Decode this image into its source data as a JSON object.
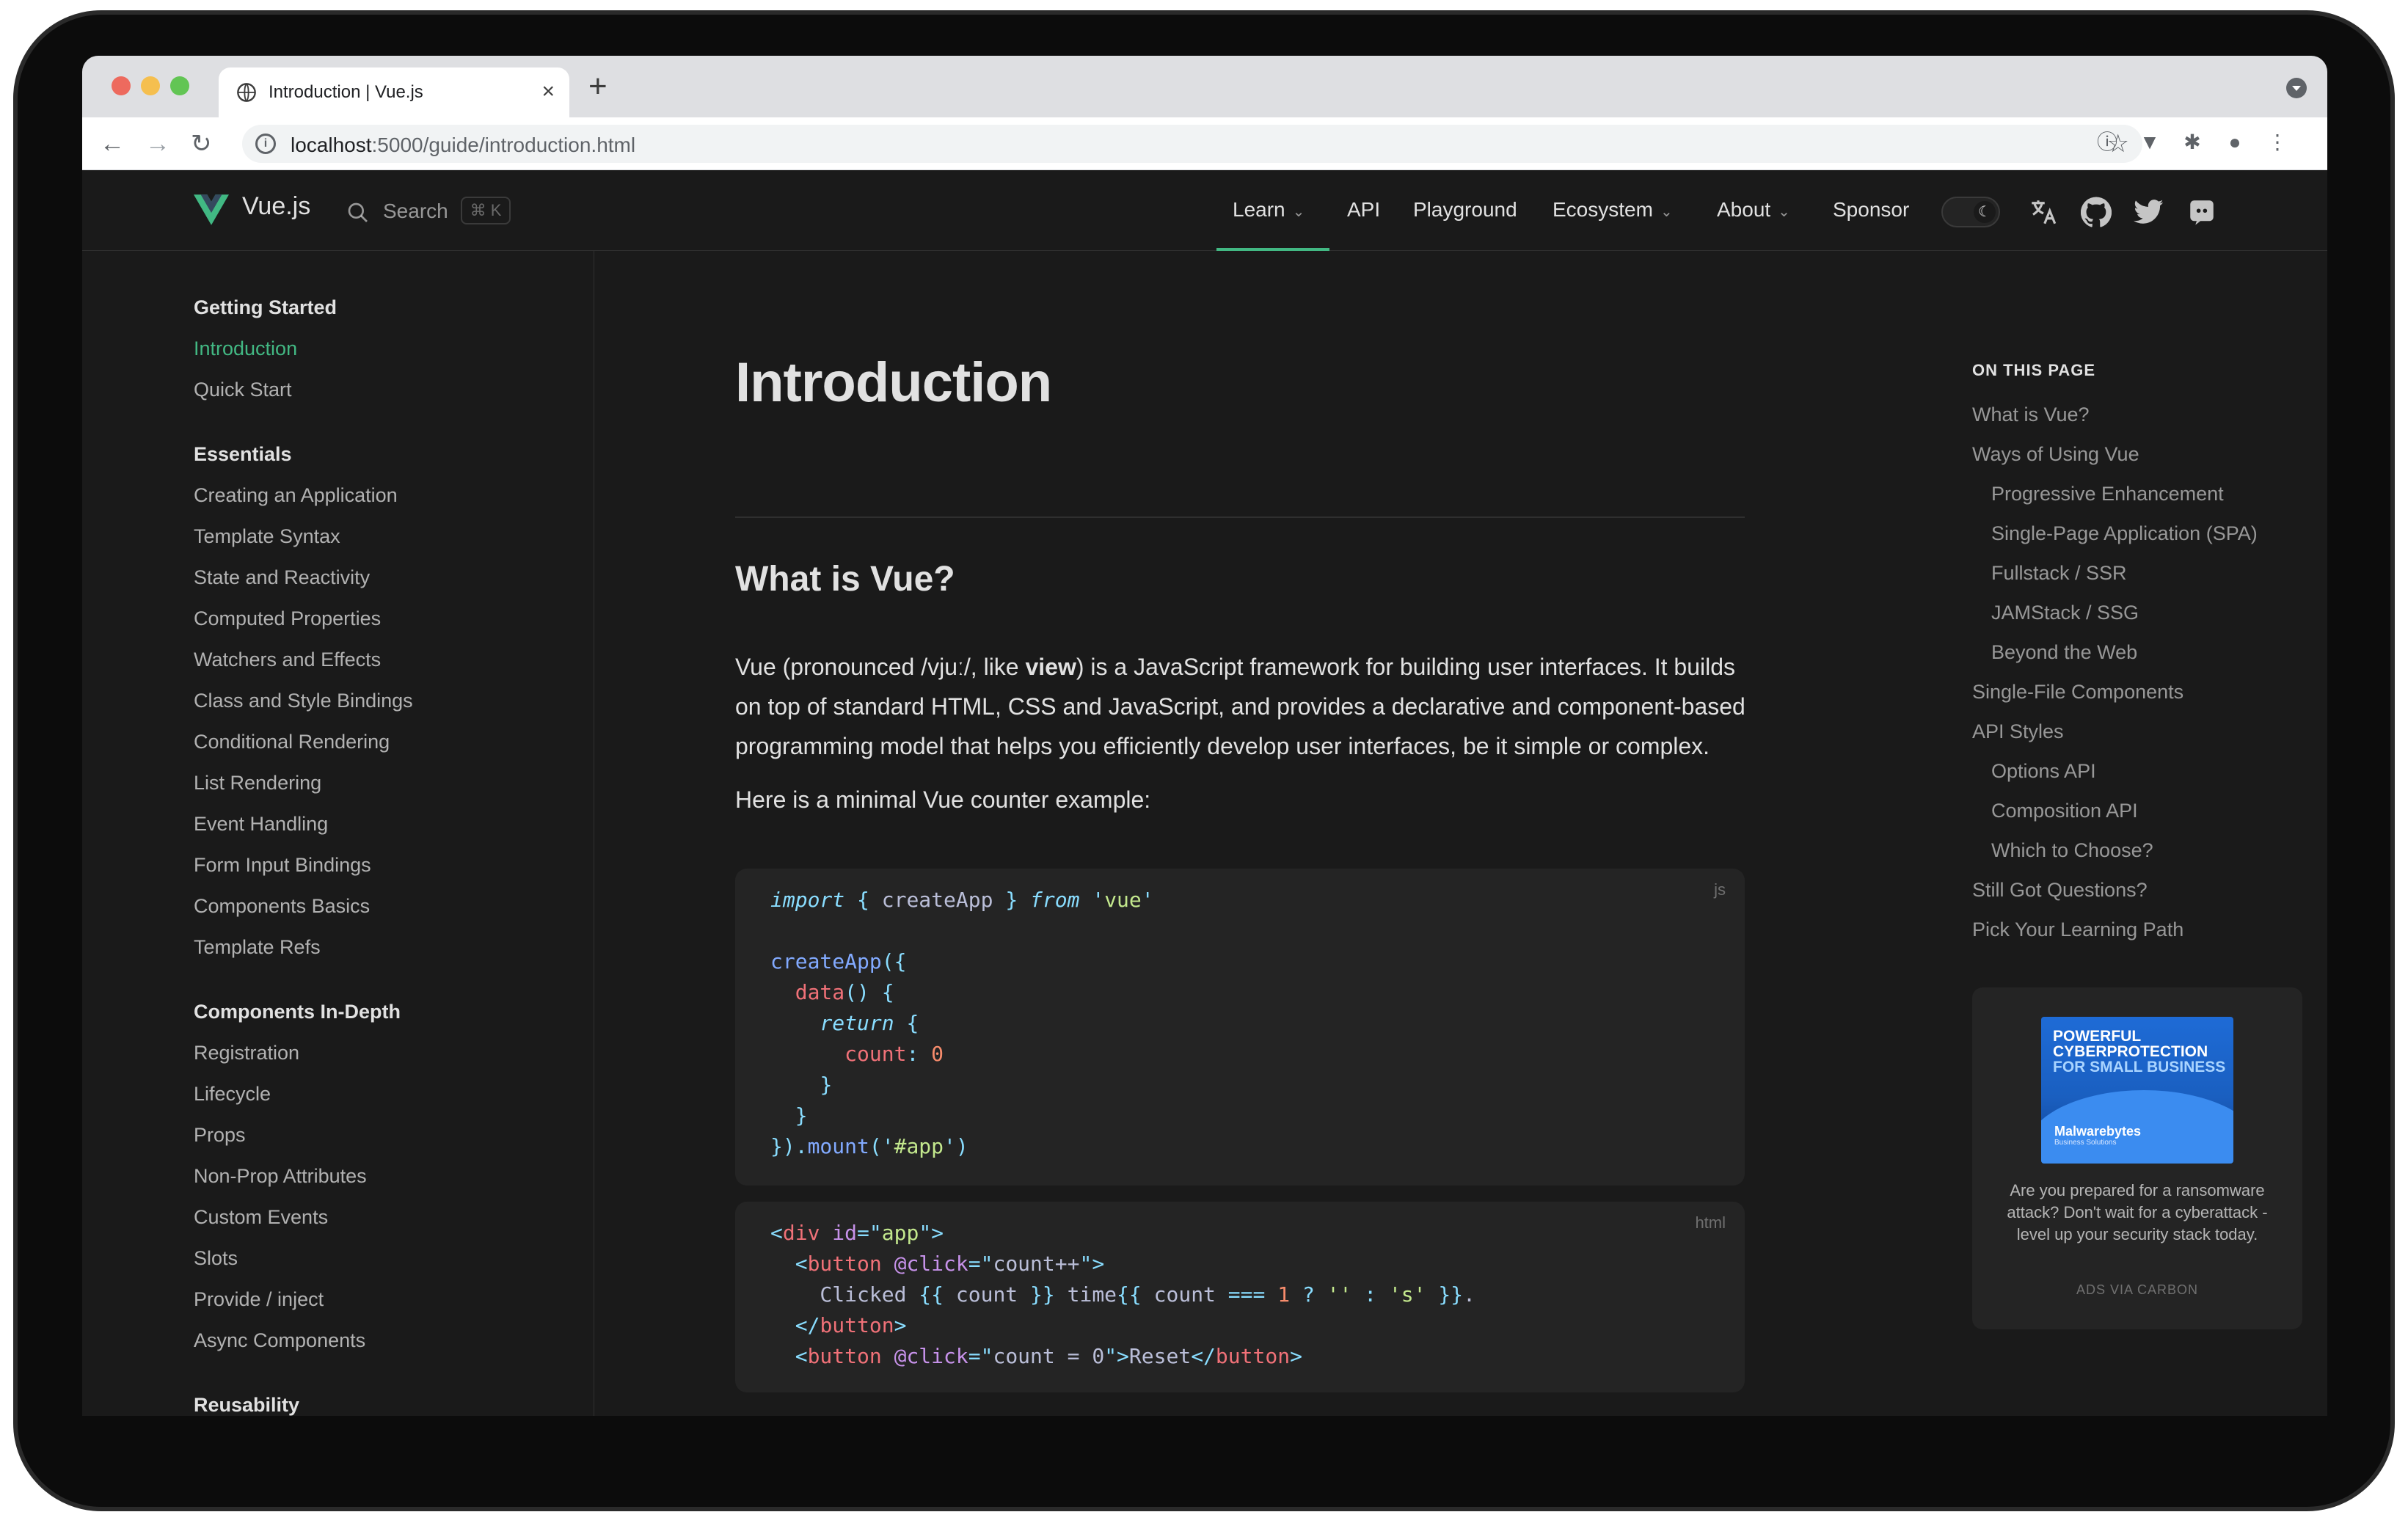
{
  "browser": {
    "tab_title": "Introduction | Vue.js",
    "url_host": "localhost",
    "url_rest": ":5000/guide/introduction.html",
    "new_tab_symbol": "+",
    "close_symbol": "×"
  },
  "nav": {
    "brand": "Vue.js",
    "search_label": "Search",
    "search_shortcut": "⌘ K",
    "items": [
      {
        "label": "Learn",
        "has_dropdown": true,
        "active": true
      },
      {
        "label": "API",
        "has_dropdown": false
      },
      {
        "label": "Playground",
        "has_dropdown": false
      },
      {
        "label": "Ecosystem",
        "has_dropdown": true
      },
      {
        "label": "About",
        "has_dropdown": true
      },
      {
        "label": "Sponsor",
        "has_dropdown": false
      }
    ],
    "chevron": "⌄",
    "accent_color": "#42b883"
  },
  "sidebar": {
    "groups": [
      {
        "title": "Getting Started",
        "items": [
          "Introduction",
          "Quick Start"
        ]
      },
      {
        "title": "Essentials",
        "items": [
          "Creating an Application",
          "Template Syntax",
          "State and Reactivity",
          "Computed Properties",
          "Watchers and Effects",
          "Class and Style Bindings",
          "Conditional Rendering",
          "List Rendering",
          "Event Handling",
          "Form Input Bindings",
          "Components Basics",
          "Template Refs"
        ]
      },
      {
        "title": "Components In-Depth",
        "items": [
          "Registration",
          "Lifecycle",
          "Props",
          "Non-Prop Attributes",
          "Custom Events",
          "Slots",
          "Provide / inject",
          "Async Components"
        ]
      },
      {
        "title": "Reusability",
        "items": []
      }
    ],
    "active_item": "Introduction"
  },
  "content": {
    "title": "Introduction",
    "section_title": "What is Vue?",
    "para_before": "Vue (pronounced /vjuː/, like ",
    "para_bold": "view",
    "para_after": ") is a JavaScript framework for building user interfaces. It builds on top of standard HTML, CSS and JavaScript, and provides a declarative and component-based programming model that helps you efficiently develop user interfaces, be it simple or complex.",
    "para2": "Here is a minimal Vue counter example:",
    "code_js_lang": "js",
    "code_html_lang": "html",
    "code_js": [
      [
        [
          "kw",
          "import"
        ],
        [
          "plain",
          " "
        ],
        [
          "punc",
          "{"
        ],
        [
          "plain",
          " createApp "
        ],
        [
          "punc",
          "}"
        ],
        [
          "plain",
          " "
        ],
        [
          "kw",
          "from"
        ],
        [
          "plain",
          " "
        ],
        [
          "punc",
          "'"
        ],
        [
          "str",
          "vue"
        ],
        [
          "punc",
          "'"
        ]
      ],
      [],
      [
        [
          "fn",
          "createApp"
        ],
        [
          "punc",
          "({"
        ]
      ],
      [
        [
          "plain",
          "  "
        ],
        [
          "prop",
          "data"
        ],
        [
          "punc",
          "()"
        ],
        [
          "plain",
          " "
        ],
        [
          "punc",
          "{"
        ]
      ],
      [
        [
          "plain",
          "    "
        ],
        [
          "kw",
          "return"
        ],
        [
          "plain",
          " "
        ],
        [
          "punc",
          "{"
        ]
      ],
      [
        [
          "plain",
          "      "
        ],
        [
          "prop",
          "count"
        ],
        [
          "punc",
          ":"
        ],
        [
          "plain",
          " "
        ],
        [
          "num",
          "0"
        ]
      ],
      [
        [
          "plain",
          "    "
        ],
        [
          "punc",
          "}"
        ]
      ],
      [
        [
          "plain",
          "  "
        ],
        [
          "punc",
          "}"
        ]
      ],
      [
        [
          "punc",
          "})."
        ],
        [
          "fn",
          "mount"
        ],
        [
          "punc",
          "('"
        ],
        [
          "str",
          "#app"
        ],
        [
          "punc",
          "')"
        ]
      ]
    ],
    "code_html": [
      [
        [
          "punc",
          "<"
        ],
        [
          "tag",
          "div"
        ],
        [
          "plain",
          " "
        ],
        [
          "attr",
          "id"
        ],
        [
          "punc",
          "=\""
        ],
        [
          "str",
          "app"
        ],
        [
          "punc",
          "\">"
        ]
      ],
      [
        [
          "plain",
          "  "
        ],
        [
          "punc",
          "<"
        ],
        [
          "tag",
          "button"
        ],
        [
          "plain",
          " "
        ],
        [
          "attr",
          "@click"
        ],
        [
          "punc",
          "=\""
        ],
        [
          "plain",
          "count++"
        ],
        [
          "punc",
          "\">"
        ]
      ],
      [
        [
          "plain",
          "    Clicked "
        ],
        [
          "punc",
          "{{"
        ],
        [
          "plain",
          " count "
        ],
        [
          "punc",
          "}}"
        ],
        [
          "plain",
          " time"
        ],
        [
          "punc",
          "{{"
        ],
        [
          "plain",
          " count "
        ],
        [
          "punc",
          "==="
        ],
        [
          "plain",
          " "
        ],
        [
          "num",
          "1"
        ],
        [
          "plain",
          " "
        ],
        [
          "punc",
          "?"
        ],
        [
          "plain",
          " "
        ],
        [
          "str",
          "''"
        ],
        [
          "plain",
          " "
        ],
        [
          "punc",
          ":"
        ],
        [
          "plain",
          " "
        ],
        [
          "str",
          "'s'"
        ],
        [
          "plain",
          " "
        ],
        [
          "punc",
          "}}"
        ],
        [
          "plain",
          "."
        ]
      ],
      [
        [
          "plain",
          "  "
        ],
        [
          "punc",
          "</"
        ],
        [
          "tag",
          "button"
        ],
        [
          "punc",
          ">"
        ]
      ],
      [
        [
          "plain",
          "  "
        ],
        [
          "punc",
          "<"
        ],
        [
          "tag",
          "button"
        ],
        [
          "plain",
          " "
        ],
        [
          "attr",
          "@click"
        ],
        [
          "punc",
          "=\""
        ],
        [
          "plain",
          "count = 0"
        ],
        [
          "punc",
          "\">"
        ],
        [
          "plain",
          "Reset"
        ],
        [
          "punc",
          "</"
        ],
        [
          "tag",
          "button"
        ],
        [
          "punc",
          ">"
        ]
      ]
    ]
  },
  "aside": {
    "title": "ON THIS PAGE",
    "toc": [
      {
        "label": "What is Vue?",
        "level": 1
      },
      {
        "label": "Ways of Using Vue",
        "level": 1
      },
      {
        "label": "Progressive Enhancement",
        "level": 2
      },
      {
        "label": "Single-Page Application (SPA)",
        "level": 2
      },
      {
        "label": "Fullstack / SSR",
        "level": 2
      },
      {
        "label": "JAMStack / SSG",
        "level": 2
      },
      {
        "label": "Beyond the Web",
        "level": 2
      },
      {
        "label": "Single-File Components",
        "level": 1
      },
      {
        "label": "API Styles",
        "level": 1
      },
      {
        "label": "Options API",
        "level": 2
      },
      {
        "label": "Composition API",
        "level": 2
      },
      {
        "label": "Which to Choose?",
        "level": 2
      },
      {
        "label": "Still Got Questions?",
        "level": 1
      },
      {
        "label": "Pick Your Learning Path",
        "level": 1
      }
    ],
    "ad": {
      "headline_1": "POWERFUL",
      "headline_2": "CYBERPROTECTION",
      "headline_3": "FOR SMALL BUSINESS",
      "brand": "Malwarebytes",
      "brand_sub": "Business Solutions",
      "text": "Are you prepared for a ransomware attack? Don't wait for a cyberattack - level up your security stack today.",
      "via": "ADS VIA CARBON"
    }
  }
}
